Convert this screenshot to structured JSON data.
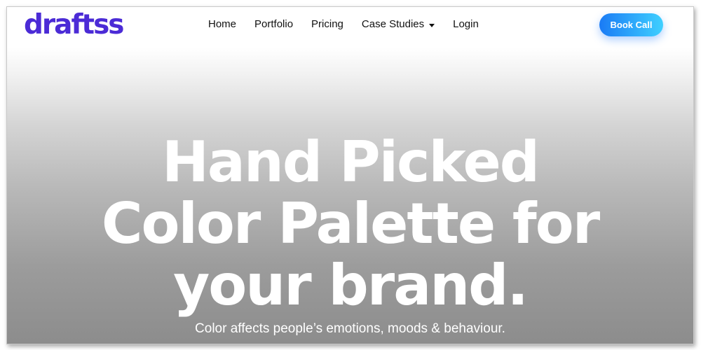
{
  "brand": {
    "logo_text": "draftss",
    "color": "#4b2bd6"
  },
  "nav": {
    "items": [
      {
        "label": "Home"
      },
      {
        "label": "Portfolio"
      },
      {
        "label": "Pricing"
      },
      {
        "label": "Case Studies",
        "has_dropdown": true,
        "icon": "caret-down-icon"
      },
      {
        "label": "Login"
      }
    ]
  },
  "cta": {
    "label": "Book Call",
    "gradient_left": "#1a7bf5",
    "gradient_right": "#3fd0ff"
  },
  "hero": {
    "title_lines": [
      "Hand Picked",
      "Color Palette for",
      "your brand."
    ],
    "subtitle": "Color affects people’s emotions, moods & behaviour."
  }
}
